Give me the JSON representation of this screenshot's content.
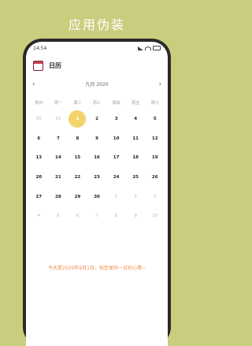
{
  "headline": "应用伪装",
  "status": {
    "time": "14:54"
  },
  "app": {
    "title": "日历"
  },
  "calendar": {
    "month_label": "九月 2020",
    "weekdays": [
      "周日",
      "周一",
      "周二",
      "周三",
      "周四",
      "周五",
      "周六"
    ],
    "weeks": [
      [
        {
          "d": "30",
          "m": 1
        },
        {
          "d": "31",
          "m": 1
        },
        {
          "d": "1",
          "s": 1
        },
        {
          "d": "2"
        },
        {
          "d": "3"
        },
        {
          "d": "4"
        },
        {
          "d": "5"
        }
      ],
      [
        {
          "d": "6"
        },
        {
          "d": "7"
        },
        {
          "d": "8"
        },
        {
          "d": "9"
        },
        {
          "d": "10"
        },
        {
          "d": "11"
        },
        {
          "d": "12"
        }
      ],
      [
        {
          "d": "13"
        },
        {
          "d": "14"
        },
        {
          "d": "15"
        },
        {
          "d": "16"
        },
        {
          "d": "17"
        },
        {
          "d": "18"
        },
        {
          "d": "19"
        }
      ],
      [
        {
          "d": "20"
        },
        {
          "d": "21"
        },
        {
          "d": "22"
        },
        {
          "d": "23"
        },
        {
          "d": "24"
        },
        {
          "d": "25"
        },
        {
          "d": "26"
        }
      ],
      [
        {
          "d": "27"
        },
        {
          "d": "28"
        },
        {
          "d": "29"
        },
        {
          "d": "30"
        },
        {
          "d": "1",
          "m": 1
        },
        {
          "d": "2",
          "m": 1
        },
        {
          "d": "3",
          "m": 1
        }
      ],
      [
        {
          "d": "4",
          "m": 1
        },
        {
          "d": "5",
          "m": 1
        },
        {
          "d": "6",
          "m": 1
        },
        {
          "d": "7",
          "m": 1
        },
        {
          "d": "8",
          "m": 1
        },
        {
          "d": "9",
          "m": 1
        },
        {
          "d": "10",
          "m": 1
        }
      ]
    ]
  },
  "footer": "今天是2020年9月1日，祝您保持一日好心情~",
  "colors": {
    "background": "#c9cd7e",
    "selected": "#f3d36b",
    "footer_text": "#f08a4b"
  }
}
